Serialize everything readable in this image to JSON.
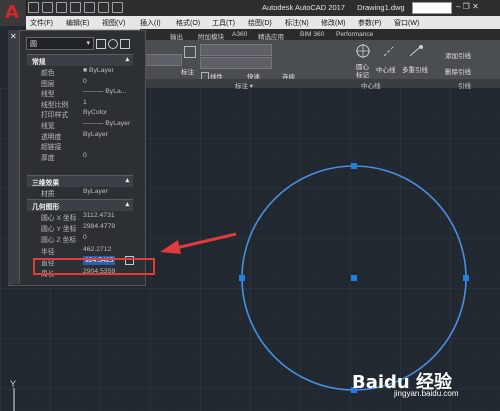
{
  "app": {
    "logo_letter": "A",
    "title": "Autodesk AutoCAD 2017",
    "document": "Drawing1.dwg",
    "window_controls": "– ❐ ✕"
  },
  "menu": [
    "文件(F)",
    "编辑(E)",
    "视图(V)",
    "插入(I)",
    "格式(O)",
    "工具(T)",
    "绘图(D)",
    "标注(N)",
    "修改(M)",
    "参数(P)",
    "窗口(W)"
  ],
  "ribbon": {
    "tabs": [
      "输出",
      "附加模块",
      "A360",
      "精选应用",
      "BIM 360",
      "Performance"
    ],
    "texts": {
      "annotate": "标注",
      "linear": "线性",
      "quick": "快速",
      "continue": "连续",
      "center_mark": "圆心\n标记",
      "center_line": "中心线",
      "multileader": "多重引线",
      "add_leader": "添加引线",
      "remove_leader": "删除引线"
    },
    "panels": [
      "标注 ▾",
      "中心线",
      "引线"
    ]
  },
  "properties": {
    "selection": "圆",
    "sections": {
      "general": "常规",
      "three_d": "三维效果",
      "geometry": "几何图形"
    },
    "general_rows": [
      {
        "k": "颜色",
        "v": "■ ByLayer"
      },
      {
        "k": "图层",
        "v": "0"
      },
      {
        "k": "线型",
        "v": "——— ByLa..."
      },
      {
        "k": "线型比例",
        "v": "1"
      },
      {
        "k": "打印样式",
        "v": "ByColor"
      },
      {
        "k": "线宽",
        "v": "——— ByLayer"
      },
      {
        "k": "透明度",
        "v": "ByLayer"
      },
      {
        "k": "超链接",
        "v": ""
      },
      {
        "k": "厚度",
        "v": "0"
      }
    ],
    "three_d_rows": [
      {
        "k": "材质",
        "v": "ByLayer"
      }
    ],
    "geometry_rows": [
      {
        "k": "圆心 X 坐标",
        "v": "3112.4731"
      },
      {
        "k": "圆心 Y 坐标",
        "v": "2984.4779"
      },
      {
        "k": "圆心 Z 坐标",
        "v": "0"
      },
      {
        "k": "半径",
        "v": "462.2712"
      },
      {
        "k": "直径",
        "v": "924.5425"
      },
      {
        "k": "周长",
        "v": "2904.5359"
      }
    ]
  },
  "canvas": {
    "axis_label": "Y"
  },
  "watermark": {
    "brand": "Baidu 经验",
    "url": "jingyan.baidu.com"
  },
  "colors": {
    "circle": "#4a8fe0",
    "grip": "#1e7fe6",
    "arrow": "#e23b3b",
    "highlight": "#2b5fa8"
  }
}
